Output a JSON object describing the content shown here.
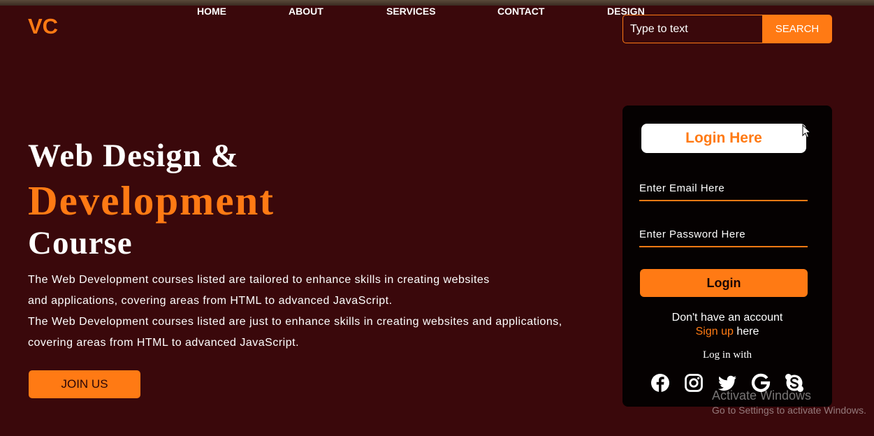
{
  "brand": {
    "logo": "VC"
  },
  "nav": [
    "HOME",
    "ABOUT",
    "SERVICES",
    "CONTACT",
    "DESIGN"
  ],
  "search": {
    "placeholder": "Type to text",
    "button": "SEARCH"
  },
  "hero": {
    "title_line1": "Web Design &",
    "title_line2": "Development",
    "title_line3": "Course",
    "description": [
      "The Web Development courses listed are tailored to enhance skills in creating websites",
      "and applications, covering areas from HTML to advanced JavaScript.",
      "The Web Development courses listed are just to enhance skills in creating websites and applications,",
      "covering areas from HTML to advanced JavaScript."
    ],
    "join_button": "JOIN US"
  },
  "login": {
    "heading": "Login Here",
    "email_placeholder": "Enter Email Here",
    "password_placeholder": "Enter Password Here",
    "button": "Login",
    "no_account": "Don't have an account",
    "signup_link": "Sign up",
    "signup_suffix": " here",
    "login_with": "Log in with",
    "socials": [
      "facebook-icon",
      "instagram-icon",
      "twitter-icon",
      "google-icon",
      "skype-icon"
    ]
  },
  "watermark": {
    "line1": "Activate Windows",
    "line2": "Go to Settings to activate Windows."
  },
  "colors": {
    "accent": "#ff7a14",
    "background": "#3a080b",
    "panel": "#050101"
  }
}
